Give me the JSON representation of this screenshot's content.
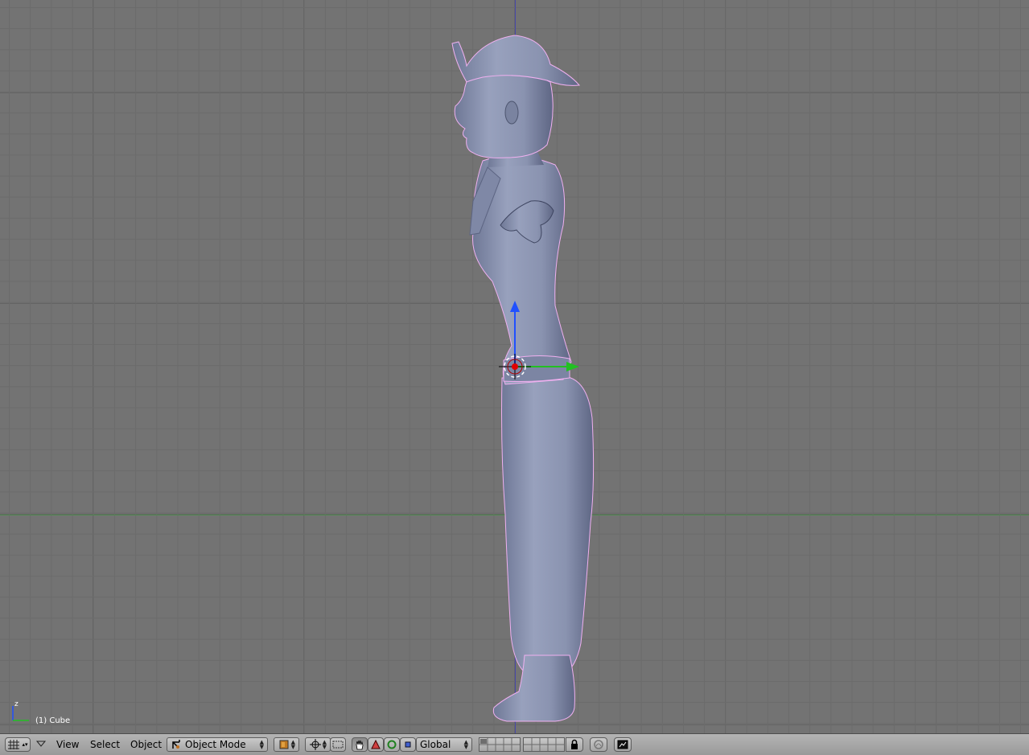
{
  "viewport": {
    "object_label": "(1) Cube",
    "axis_indicator_label": "z"
  },
  "header": {
    "menus": [
      "View",
      "Select",
      "Object"
    ],
    "mode_label": "Object Mode",
    "orientation_label": "Global"
  },
  "icons": {
    "editor_type": "grid-icon",
    "collapse": "triangle-down-icon",
    "mode": "object-mode-icon",
    "shading": "solid-shading-icon",
    "pivot": "pivot-point-icon",
    "snap": "snap-icon",
    "manipulator": "hand-manipulator-icon",
    "translate": "translate-manipulator-icon",
    "rotate": "rotate-manipulator-icon",
    "scale": "scale-manipulator-icon",
    "layers_lock": "lock-icon",
    "proportional": "proportional-edit-icon",
    "render": "render-icon"
  },
  "colors": {
    "grid_background": "#737373",
    "mesh": "#8a93b0",
    "selection_outline": "#f0b0f0",
    "axis_x": "#4d8a4d",
    "axis_z": "#4848a8",
    "gizmo_y": "#22c022",
    "gizmo_z": "#2050ff",
    "origin": "#e00000"
  }
}
